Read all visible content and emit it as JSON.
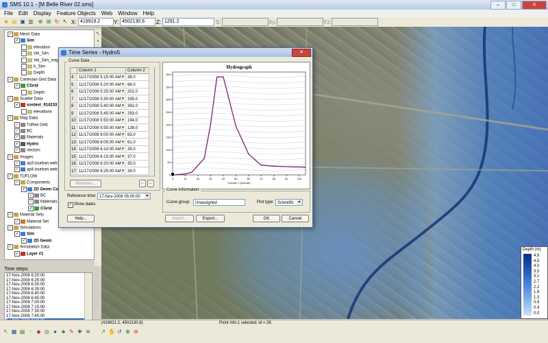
{
  "window": {
    "title": "SMS 10.1 - [M Belle River 02.sms]",
    "min": "–",
    "max": "□",
    "close": "✕"
  },
  "menu": [
    "File",
    "Edit",
    "Display",
    "Feature Objects",
    "Web",
    "Window",
    "Help"
  ],
  "toolbar": {
    "x_label": "X:",
    "x_value": "419919.2",
    "y_label": "Y:",
    "y_value": "4502130.6",
    "z_label": "Z:",
    "z_value": "1291.2",
    "s_label": "S:",
    "xy_label": "Xy:",
    "yz_label": "Yz:"
  },
  "tree": [
    {
      "text": "Mesh Data",
      "indent": 0,
      "check": true,
      "bold": false,
      "color": "#caa24b"
    },
    {
      "text": "Sim",
      "indent": 1,
      "check": true,
      "bold": true,
      "color": "#3a7ed0"
    },
    {
      "text": "elevation",
      "indent": 2,
      "check": false,
      "bold": false,
      "color": "#bdbd7a"
    },
    {
      "text": "Vel_Sim",
      "indent": 2,
      "check": false,
      "bold": false,
      "color": "#bdbd7a"
    },
    {
      "text": "Vel_Sim_mag",
      "indent": 2,
      "check": false,
      "bold": false,
      "color": "#bdbd7a"
    },
    {
      "text": "h_Sim",
      "indent": 2,
      "check": false,
      "bold": false,
      "color": "#bdbd7a"
    },
    {
      "text": "Depth",
      "indent": 2,
      "check": false,
      "bold": false,
      "color": "#bdbd7a"
    },
    {
      "text": "Cartesian Grid Data",
      "indent": 0,
      "check": true,
      "bold": false,
      "color": "#caa24b"
    },
    {
      "text": "CGrid",
      "indent": 1,
      "check": true,
      "bold": true,
      "color": "#3a9a3a"
    },
    {
      "text": "Depth",
      "indent": 2,
      "check": false,
      "bold": false,
      "color": "#bdbd7a"
    },
    {
      "text": "Scatter Data",
      "indent": 0,
      "check": true,
      "bold": false,
      "color": "#caa24b"
    },
    {
      "text": "sostest_914233",
      "indent": 1,
      "check": true,
      "bold": true,
      "color": "#c03030"
    },
    {
      "text": "elevations",
      "indent": 2,
      "check": false,
      "bold": false,
      "color": "#bdbd7a"
    },
    {
      "text": "Map Data",
      "indent": 0,
      "check": true,
      "bold": false,
      "color": "#caa24b"
    },
    {
      "text": "Tuflow Grid",
      "indent": 1,
      "check": true,
      "bold": false,
      "color": "#888888"
    },
    {
      "text": "BC",
      "indent": 1,
      "check": true,
      "bold": false,
      "color": "#888888"
    },
    {
      "text": "Materials",
      "indent": 1,
      "check": true,
      "bold": false,
      "color": "#888888"
    },
    {
      "text": "Hydro",
      "indent": 1,
      "check": true,
      "bold": true,
      "color": "#555555"
    },
    {
      "text": "Vectors",
      "indent": 1,
      "check": true,
      "bold": false,
      "color": "#888888"
    },
    {
      "text": "Images",
      "indent": 0,
      "check": true,
      "bold": false,
      "color": "#caa24b"
    },
    {
      "text": "ap3.tourban.web",
      "indent": 1,
      "check": true,
      "bold": false,
      "color": "#4a7cc2"
    },
    {
      "text": "ap4.tourban.web",
      "indent": 1,
      "check": true,
      "bold": false,
      "color": "#4a7cc2"
    },
    {
      "text": "TUFLOW",
      "indent": 0,
      "check": true,
      "bold": false,
      "color": "#caa24b"
    },
    {
      "text": "Components",
      "indent": 1,
      "check": true,
      "bold": false,
      "color": "#caa24b"
    },
    {
      "text": "2D Geom Co",
      "indent": 2,
      "check": true,
      "bold": true,
      "color": "#3a7ed0"
    },
    {
      "text": "BC",
      "indent": 3,
      "check": true,
      "bold": false,
      "color": "#888888"
    },
    {
      "text": "Materials",
      "indent": 3,
      "check": true,
      "bold": false,
      "color": "#888888"
    },
    {
      "text": "CGrid",
      "indent": 3,
      "check": true,
      "bold": true,
      "color": "#3a9a3a"
    },
    {
      "text": "Material Sets",
      "indent": 0,
      "check": true,
      "bold": false,
      "color": "#caa24b"
    },
    {
      "text": "Material Set",
      "indent": 1,
      "check": true,
      "bold": false,
      "color": "#c07a30"
    },
    {
      "text": "Simulations",
      "indent": 0,
      "check": true,
      "bold": false,
      "color": "#caa24b"
    },
    {
      "text": "Sim",
      "indent": 1,
      "check": true,
      "bold": true,
      "color": "#3a7ed0"
    },
    {
      "text": "2D Geom",
      "indent": 2,
      "check": true,
      "bold": true,
      "color": "#3a7ed0"
    },
    {
      "text": "Annotation Data",
      "indent": 0,
      "check": true,
      "bold": false,
      "color": "#caa24b"
    },
    {
      "text": "Layer #1",
      "indent": 1,
      "check": true,
      "bold": true,
      "color": "#c03030"
    }
  ],
  "timesteps": {
    "label": "Time steps:",
    "items": [
      "17-Nov-2008 6:20:00",
      "17-Nov-2008 6:25:00",
      "17-Nov-2008 6:30:00",
      "17-Nov-2008 6:35:00",
      "17-Nov-2008 6:40:00",
      "17-Nov-2008 6:45:00",
      "17-Nov-2008 7:00:00",
      "17-Nov-2008 7:15:00",
      "17-Nov-2008 7:30:00",
      "17-Nov-2008 7:45:00",
      "17-Nov-2008 8:00:00"
    ],
    "selected": 10
  },
  "legend": {
    "title": "Depth (m)",
    "levels": [
      "4.9",
      "4.5",
      "4.0",
      "3.5",
      "3.1",
      "2.7",
      "2.2",
      "1.8",
      "1.3",
      "0.9",
      "0.4",
      "0.0"
    ]
  },
  "status": {
    "coords": "(419921.2, 4502130.8)",
    "info": "Point info:1 selected; id = 28."
  },
  "dialog": {
    "title": "Time Series - Hydro5",
    "close": "✕",
    "curve_data_label": "Curve Data",
    "col1": "Column 1",
    "col2": "Column 2",
    "rows": [
      {
        "n": "4",
        "d": "11/17/2008 5:15:00 AM",
        "v": "38.0"
      },
      {
        "n": "5",
        "d": "11/17/2008 5:20:00 AM",
        "v": "66.0"
      },
      {
        "n": "6",
        "d": "11/17/2008 5:25:00 AM",
        "v": "201.0"
      },
      {
        "n": "7",
        "d": "11/17/2008 5:30:00 AM",
        "v": "335.0"
      },
      {
        "n": "8",
        "d": "11/17/2008 5:40:00 AM",
        "v": "391.0"
      },
      {
        "n": "9",
        "d": "11/17/2008 5:45:00 AM",
        "v": "293.0"
      },
      {
        "n": "10",
        "d": "11/17/2008 5:50:00 AM",
        "v": "194.0"
      },
      {
        "n": "11",
        "d": "11/17/2008 5:55:00 AM",
        "v": "139.0"
      },
      {
        "n": "12",
        "d": "11/17/2008 6:00:00 AM",
        "v": "83.0"
      },
      {
        "n": "13",
        "d": "11/17/2008 6:05:00 AM",
        "v": "61.0"
      },
      {
        "n": "14",
        "d": "11/17/2008 6:10:00 AM",
        "v": "39.0"
      },
      {
        "n": "15",
        "d": "11/17/2008 6:15:00 AM",
        "v": "37.0"
      },
      {
        "n": "16",
        "d": "11/17/2008 6:20:00 AM",
        "v": "35.0"
      },
      {
        "n": "17",
        "d": "11/17/2008 6:25:00 AM",
        "v": "34.0"
      }
    ],
    "attributes_btn": "Attributes...",
    "ref_time_label": "Reference time:",
    "ref_time_value": "17-Nov-2008 05:00:00",
    "show_dates_label": "Show dates",
    "curve_info_label": "Curve Information",
    "curve_group_label": "Curve group:",
    "curve_group_value": "Unassigned",
    "plot_type_label": "Plot type:",
    "plot_type_value": "Scientific",
    "help_btn": "Help...",
    "import_btn": "Import...",
    "export_btn": "Export...",
    "ok_btn": "OK",
    "cancel_btn": "Cancel"
  },
  "chart_data": {
    "type": "line",
    "title": "Hydrograph",
    "xlabel": "Column 1 (minute)",
    "ylabel": "",
    "xlim": [
      0,
      105
    ],
    "ylim": [
      0,
      410
    ],
    "xticks": [
      0,
      10,
      20,
      30,
      40,
      50,
      60,
      70,
      80,
      90,
      100
    ],
    "yticks": [
      0,
      50,
      100,
      150,
      200,
      250,
      300,
      350,
      400
    ],
    "series": [
      {
        "color": "#7a1f6e",
        "x": [
          0,
          5,
          10,
          15,
          20,
          25,
          30,
          35,
          40,
          45,
          50,
          55,
          60,
          65,
          70,
          75,
          80,
          85,
          90,
          95,
          100,
          105
        ],
        "y": [
          0,
          2,
          4,
          10,
          38,
          66,
          201,
          390,
          391,
          293,
          194,
          139,
          83,
          61,
          39,
          37,
          35,
          34,
          33,
          32,
          32,
          31
        ]
      }
    ]
  }
}
